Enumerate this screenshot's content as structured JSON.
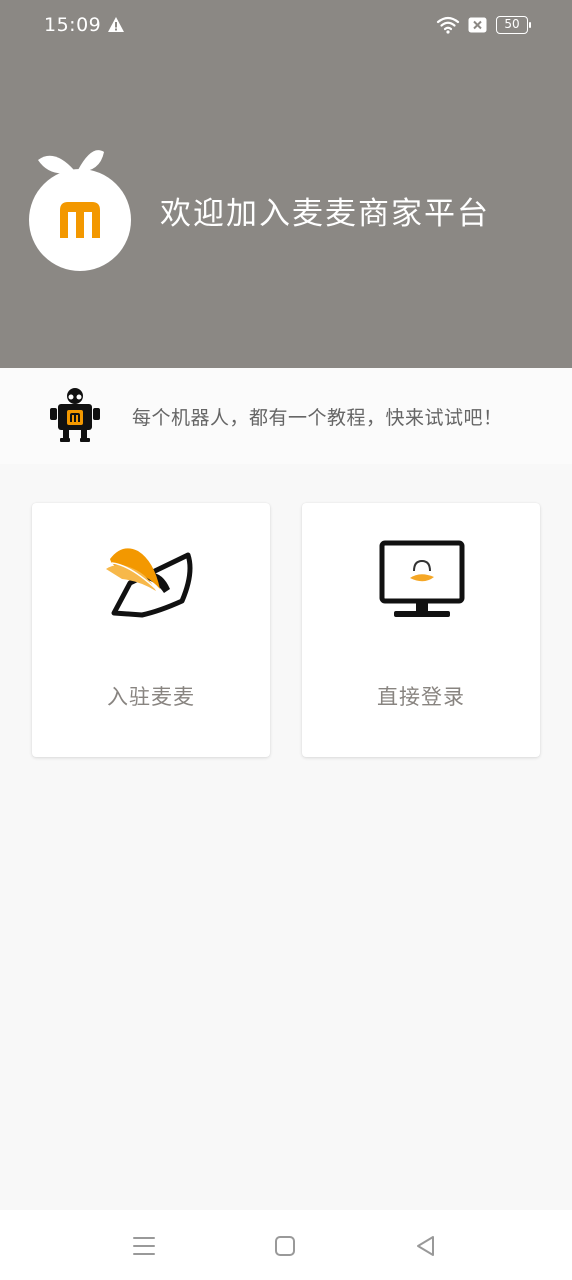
{
  "status_bar": {
    "time": "15:09",
    "battery": "50",
    "icons": [
      "warning-icon",
      "wifi-icon",
      "sim-x-icon",
      "battery-icon"
    ]
  },
  "header": {
    "title": "欢迎加入麦麦商家平台",
    "background_color": "#8b8884",
    "logo_icon": "maimai-logo-icon",
    "brand_color": "#f39800"
  },
  "tutorial": {
    "text": "每个机器人，都有一个教程，快来试试吧！",
    "icon": "robot-icon"
  },
  "cards": [
    {
      "label": "入驻麦麦",
      "icon": "register-pen-icon"
    },
    {
      "label": "直接登录",
      "icon": "monitor-login-icon"
    }
  ],
  "nav_bar": {
    "buttons": [
      "menu-icon",
      "home-icon",
      "back-icon"
    ]
  }
}
